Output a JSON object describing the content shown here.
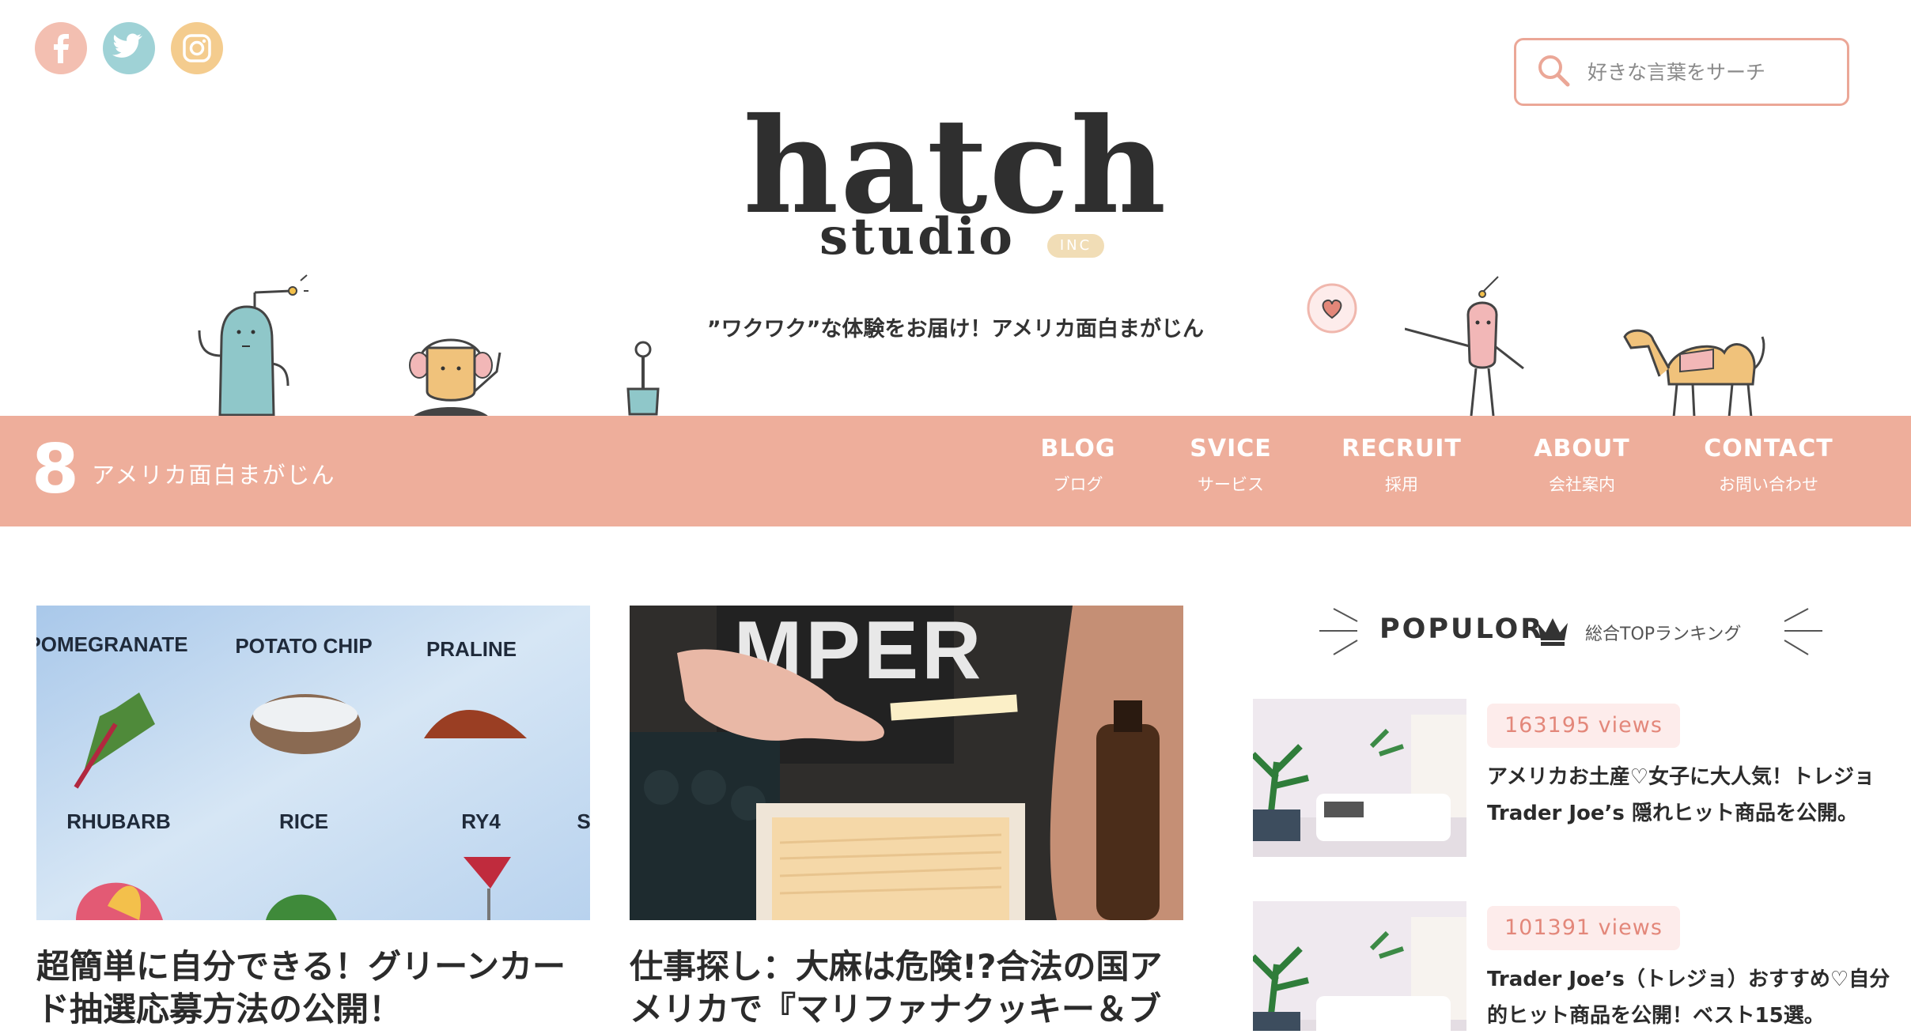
{
  "social": {
    "icons": [
      "facebook-icon",
      "twitter-icon",
      "instagram-icon"
    ],
    "colors": [
      "#f3bfb1",
      "#9fd2d6",
      "#f4cc8e"
    ]
  },
  "search": {
    "placeholder": "好きな言葉をサーチ"
  },
  "logo": {
    "main": "hatch",
    "sub": "studio",
    "badge": "INC"
  },
  "tagline": "”ワクワク”な体験をお届け！アメリカ面白まがじん",
  "nav": {
    "brand_num": "8",
    "brand_text": "アメリカ面白まがじん",
    "items": [
      {
        "en": "BLOG",
        "ja": "ブログ"
      },
      {
        "en": "SVICE",
        "ja": "サービス"
      },
      {
        "en": "RECRUIT",
        "ja": "採用"
      },
      {
        "en": "ABOUT",
        "ja": "会社案内"
      },
      {
        "en": "CONTACT",
        "ja": "お問い合わせ"
      }
    ],
    "color": "#eeae9b"
  },
  "articles": [
    {
      "title": "超簡単に自分できる！グリーンカード抽選応募方法の公開！",
      "image_labels": [
        "POMEGRANATE",
        "POTATO CHIP",
        "PRALINE",
        "RHUBARB",
        "RICE",
        "RY4",
        "S"
      ]
    },
    {
      "title": "仕事探し：大麻は危険!?合法の国アメリカで『マリファナクッキー＆ブ",
      "image_labels": [
        "MPER"
      ]
    }
  ],
  "sidebar": {
    "title": "POPULOR",
    "subtitle": "総合TOPランキング",
    "items": [
      {
        "views": "163195 views",
        "title": "アメリカお土産♡女子に大人気！トレジョ Trader Joe’s 隠れヒット商品を公開。"
      },
      {
        "views": "101391 views",
        "title": "Trader Joe’s（トレジョ）おすすめ♡自分的ヒット商品を公開！ベスト15選。"
      }
    ]
  },
  "colors": {
    "accent": "#eeae9b",
    "views_bg": "#fdeceb",
    "views_text": "#e3877a",
    "search_border": "#eba797"
  }
}
